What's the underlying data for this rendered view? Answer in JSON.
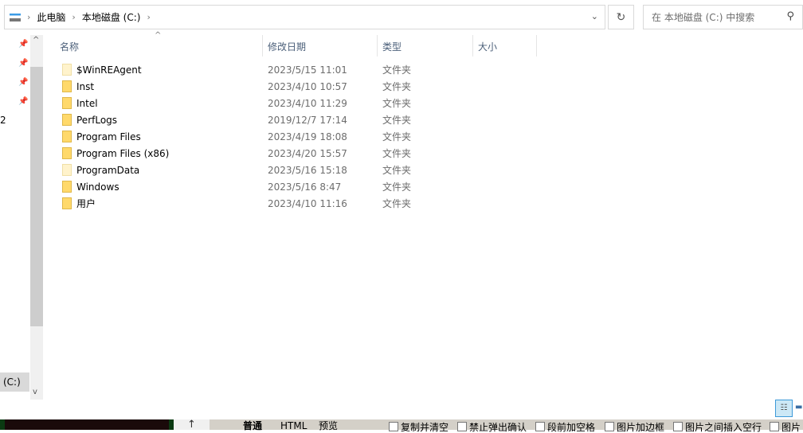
{
  "address": {
    "crumbs": [
      "此电脑",
      "本地磁盘 (C:)"
    ]
  },
  "search": {
    "placeholder": "在 本地磁盘 (C:) 中搜索"
  },
  "columns": {
    "name": "名称",
    "date": "修改日期",
    "type": "类型",
    "size": "大小"
  },
  "files": [
    {
      "name": "$WinREAgent",
      "date": "2023/5/15 11:01",
      "type": "文件夹",
      "hidden": true
    },
    {
      "name": "Inst",
      "date": "2023/4/10 10:57",
      "type": "文件夹"
    },
    {
      "name": "Intel",
      "date": "2023/4/10 11:29",
      "type": "文件夹"
    },
    {
      "name": "PerfLogs",
      "date": "2019/12/7 17:14",
      "type": "文件夹"
    },
    {
      "name": "Program Files",
      "date": "2023/4/19 18:08",
      "type": "文件夹"
    },
    {
      "name": "Program Files (x86)",
      "date": "2023/4/20 15:57",
      "type": "文件夹"
    },
    {
      "name": "ProgramData",
      "date": "2023/5/16 15:18",
      "type": "文件夹",
      "hidden": true
    },
    {
      "name": "Windows",
      "date": "2023/5/16 8:47",
      "type": "文件夹"
    },
    {
      "name": "用户",
      "date": "2023/4/10 11:16",
      "type": "文件夹"
    }
  ],
  "nav": {
    "partial_item": "2",
    "selected": "(C:)"
  },
  "bottom": {
    "tabs": [
      "普通",
      "HTML",
      "预览"
    ],
    "checkboxes": [
      "复制并清空",
      "禁止弹出确认",
      "段前加空格",
      "图片加边框",
      "图片之间插入空行",
      "图片"
    ]
  }
}
